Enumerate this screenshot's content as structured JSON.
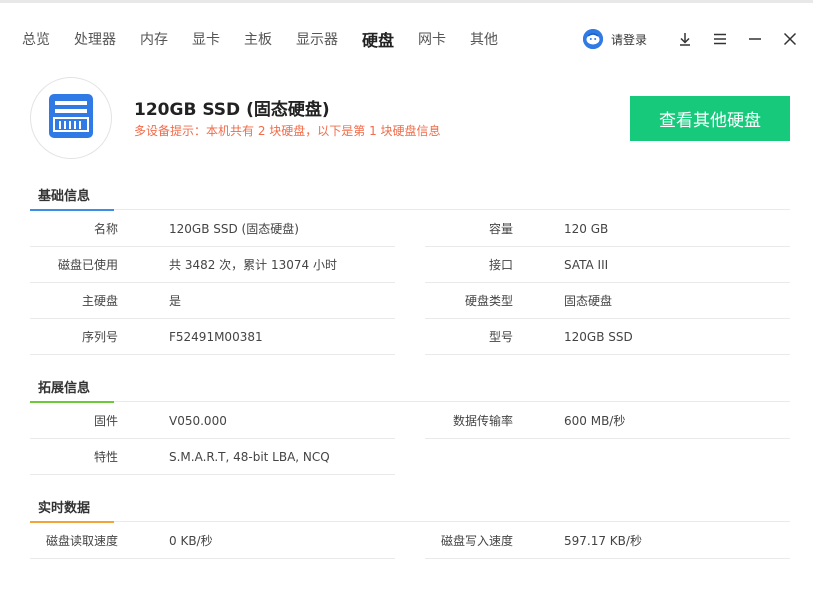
{
  "nav": {
    "items": [
      {
        "label": "总览"
      },
      {
        "label": "处理器"
      },
      {
        "label": "内存"
      },
      {
        "label": "显卡"
      },
      {
        "label": "主板"
      },
      {
        "label": "显示器"
      },
      {
        "label": "硬盘"
      },
      {
        "label": "网卡"
      },
      {
        "label": "其他"
      }
    ],
    "active_index": 6
  },
  "titlebar": {
    "login_label": "请登录",
    "icons": [
      "avatar-icon",
      "download-icon",
      "menu-icon",
      "minimize-icon",
      "close-icon"
    ]
  },
  "disk": {
    "title": "120GB SSD (固态硬盘)",
    "hint": "多设备提示：本机共有 2 块硬盘，以下是第 1 块硬盘信息",
    "other_button": "查看其他硬盘",
    "logo_icon": "ssd-icon"
  },
  "colors": {
    "accent_green": "#16c97b",
    "hint_orange": "#f06c4a",
    "section_basic": "#3f8ee6",
    "section_ext": "#6cc93a",
    "section_realtime": "#f0a43a"
  },
  "sections": {
    "basic": {
      "title": "基础信息",
      "rows": [
        {
          "left_label": "名称",
          "left_value": "120GB SSD (固态硬盘)",
          "right_label": "容量",
          "right_value": "120 GB"
        },
        {
          "left_label": "磁盘已使用",
          "left_value": "共 3482 次，累计 13074 小时",
          "right_label": "接口",
          "right_value": "SATA III"
        },
        {
          "left_label": "主硬盘",
          "left_value": "是",
          "right_label": "硬盘类型",
          "right_value": "固态硬盘"
        },
        {
          "left_label": "序列号",
          "left_value": "F52491M00381",
          "right_label": "型号",
          "right_value": "120GB SSD"
        }
      ]
    },
    "ext": {
      "title": "拓展信息",
      "rows": [
        {
          "left_label": "固件",
          "left_value": "V050.000",
          "right_label": "数据传输率",
          "right_value": "600 MB/秒"
        },
        {
          "left_label": "特性",
          "left_value": "S.M.A.R.T, 48-bit LBA, NCQ"
        }
      ]
    },
    "realtime": {
      "title": "实时数据",
      "rows": [
        {
          "left_label": "磁盘读取速度",
          "left_value": "0 KB/秒",
          "right_label": "磁盘写入速度",
          "right_value": "597.17 KB/秒"
        }
      ]
    }
  }
}
